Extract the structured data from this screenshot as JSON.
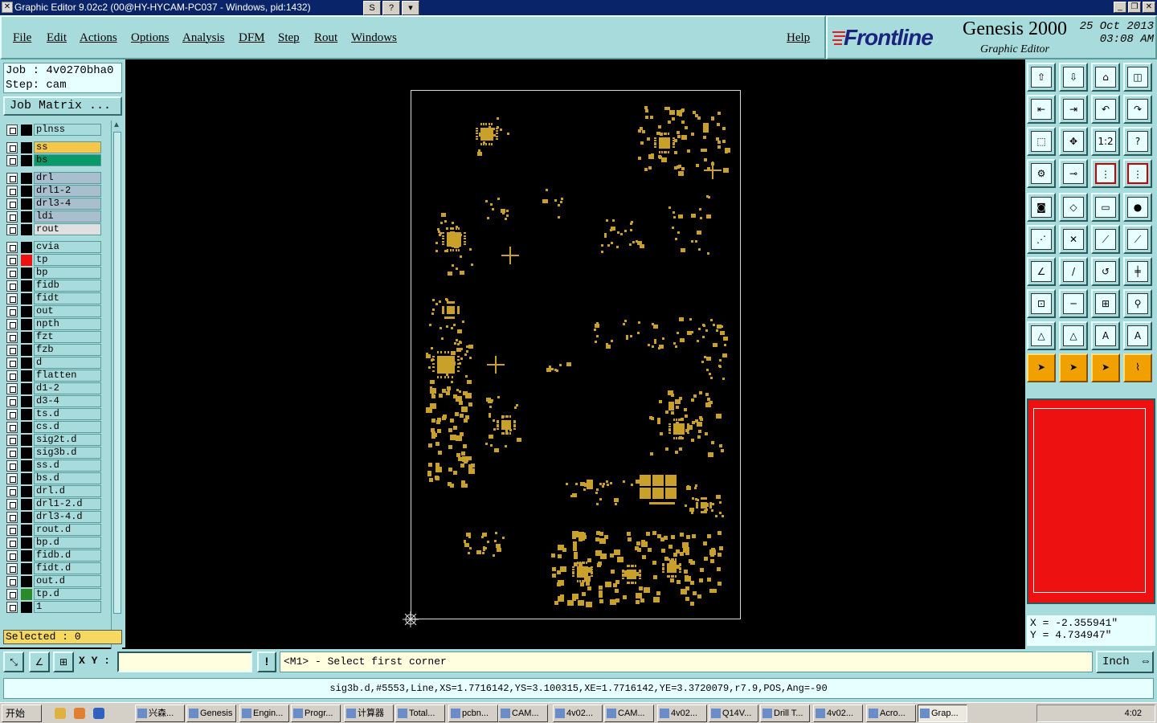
{
  "window": {
    "title": "Graphic Editor 9.02c2 (00@HY-HYCAM-PC037 - Windows, pid:1432)"
  },
  "menu": [
    "File",
    "Edit",
    "Actions",
    "Options",
    "Analysis",
    "DFM",
    "Step",
    "Rout",
    "Windows"
  ],
  "help_label": "Help",
  "brand": {
    "logo": "Frontline",
    "product": "Genesis 2000",
    "subtitle": "Graphic Editor",
    "date": "25 Oct 2013",
    "time": "03:08 AM"
  },
  "job": {
    "job_line": "Job : 4v0270bha0",
    "step_line": "Step: cam",
    "matrix_button": "Job Matrix ..."
  },
  "layers": [
    {
      "name": "plnss",
      "color": "#000000",
      "bg": "#a8dcdc"
    },
    {
      "name": "ss",
      "color": "#000000",
      "bg": "#f5c64a"
    },
    {
      "name": "bs",
      "color": "#000000",
      "bg": "#0a9a6a"
    },
    {
      "name": "drl",
      "color": "#000000",
      "bg": "#a9bfd0"
    },
    {
      "name": "drl1-2",
      "color": "#000000",
      "bg": "#a9bfd0"
    },
    {
      "name": "drl3-4",
      "color": "#000000",
      "bg": "#a9bfd0"
    },
    {
      "name": "ldi",
      "color": "#000000",
      "bg": "#a9bfd0"
    },
    {
      "name": "rout",
      "color": "#000000",
      "bg": "#e0e0e0"
    },
    {
      "name": "cvia",
      "color": "#000000",
      "bg": "#a8dcdc"
    },
    {
      "name": "tp",
      "color": "#ee1111",
      "bg": "#a8dcdc"
    },
    {
      "name": "bp",
      "color": "#000000",
      "bg": "#a8dcdc"
    },
    {
      "name": "fidb",
      "color": "#000000",
      "bg": "#a8dcdc"
    },
    {
      "name": "fidt",
      "color": "#000000",
      "bg": "#a8dcdc"
    },
    {
      "name": "out",
      "color": "#000000",
      "bg": "#a8dcdc"
    },
    {
      "name": "npth",
      "color": "#000000",
      "bg": "#a8dcdc"
    },
    {
      "name": "fzt",
      "color": "#000000",
      "bg": "#a8dcdc"
    },
    {
      "name": "fzb",
      "color": "#000000",
      "bg": "#a8dcdc"
    },
    {
      "name": "d",
      "color": "#000000",
      "bg": "#a8dcdc"
    },
    {
      "name": "flatten",
      "color": "#000000",
      "bg": "#a8dcdc"
    },
    {
      "name": "d1-2",
      "color": "#000000",
      "bg": "#a8dcdc"
    },
    {
      "name": "d3-4",
      "color": "#000000",
      "bg": "#a8dcdc"
    },
    {
      "name": "ts.d",
      "color": "#000000",
      "bg": "#a8dcdc"
    },
    {
      "name": "cs.d",
      "color": "#000000",
      "bg": "#a8dcdc"
    },
    {
      "name": "sig2t.d",
      "color": "#000000",
      "bg": "#a8dcdc"
    },
    {
      "name": "sig3b.d",
      "color": "#000000",
      "bg": "#a8dcdc"
    },
    {
      "name": "ss.d",
      "color": "#000000",
      "bg": "#a8dcdc"
    },
    {
      "name": "bs.d",
      "color": "#000000",
      "bg": "#a8dcdc"
    },
    {
      "name": "drl.d",
      "color": "#000000",
      "bg": "#a8dcdc"
    },
    {
      "name": "drl1-2.d",
      "color": "#000000",
      "bg": "#a8dcdc"
    },
    {
      "name": "drl3-4.d",
      "color": "#000000",
      "bg": "#a8dcdc"
    },
    {
      "name": "rout.d",
      "color": "#000000",
      "bg": "#a8dcdc"
    },
    {
      "name": "bp.d",
      "color": "#000000",
      "bg": "#a8dcdc"
    },
    {
      "name": "fidb.d",
      "color": "#000000",
      "bg": "#a8dcdc"
    },
    {
      "name": "fidt.d",
      "color": "#000000",
      "bg": "#a8dcdc"
    },
    {
      "name": "out.d",
      "color": "#000000",
      "bg": "#a8dcdc"
    },
    {
      "name": "tp.d",
      "color": "#2a8a2a",
      "bg": "#a8dcdc"
    },
    {
      "name": "1",
      "color": "#000000",
      "bg": "#a8dcdc"
    }
  ],
  "selected_label": "Selected : 0",
  "coords": {
    "x": "X = -2.355941\"",
    "y": "Y = 4.734947\""
  },
  "cmd": {
    "xy_label": "X Y :",
    "xy_value": "",
    "excl": "!",
    "prompt": "<M1> - Select first corner",
    "unit": "Inch"
  },
  "status": "sig3b.d,#5553,Line,XS=1.7716142,YS=3.100315,XE=1.7716142,YE=3.3720079,r7.9,POS,Ang=-90",
  "tool_icons": [
    "zoom-home-icon",
    "zoom-in-icon",
    "home-icon",
    "window-icon",
    "pan-left-icon",
    "pan-right-icon",
    "undo-view-icon",
    "redo-view-icon",
    "fit-icon",
    "zoom-center-icon",
    "ratio-icon",
    "help-icon",
    "settings-icon",
    "snap-icon",
    "measure-icon",
    "measure2-icon",
    "feature-icon",
    "draw-icon",
    "ruler-icon",
    "pad-icon",
    "connect-icon",
    "cross-icon",
    "line-icon",
    "line2-icon",
    "angle-icon",
    "slash-icon",
    "arc-icon",
    "text-icon",
    "move-icon",
    "minus-icon",
    "dimension-icon",
    "shapes-icon",
    "triangle-icon",
    "triangle2-icon",
    "triangle3-icon",
    "triangle4-icon",
    "select-icon",
    "select2-icon",
    "select3-icon",
    "select4-icon"
  ],
  "taskbar": {
    "start": "开始",
    "tasks": [
      "兴森...",
      "Genesis",
      "Engin...",
      "Progr...",
      "计算器",
      "Total...",
      "pcbn...",
      "CAM...",
      "4v02...",
      "CAM...",
      "4v02...",
      "Q14V...",
      "Drill T...",
      "4v02...",
      "Acro...",
      "Grap..."
    ],
    "clock": "4:02"
  },
  "colors": {
    "panel": "#a8dcdc",
    "pad": "#c8a02a",
    "board_outline": "#d8d8d8"
  }
}
